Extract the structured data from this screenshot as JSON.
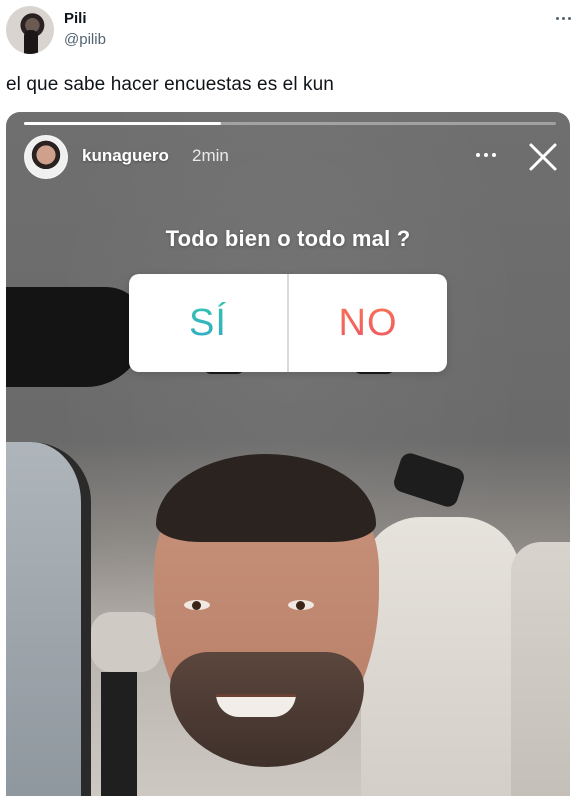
{
  "tweet": {
    "display_name": "Pili",
    "handle": "@pilib",
    "text": "el que sabe hacer encuestas es el kun",
    "more_icon": "more-horizontal-icon"
  },
  "story": {
    "username": "kunaguero",
    "time": "2min",
    "progress": 0.37,
    "poll": {
      "question": "Todo bien o todo mal ?",
      "option_yes": "SÍ",
      "option_no": "NO"
    },
    "icons": {
      "more": "more-horizontal-icon",
      "close": "close-icon"
    }
  }
}
